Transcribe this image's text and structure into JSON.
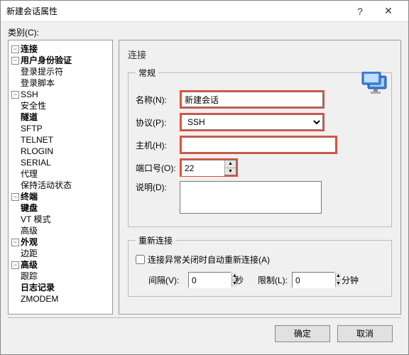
{
  "window": {
    "title": "新建会话属性",
    "help_glyph": "?",
    "close_glyph": "✕"
  },
  "tree": {
    "label": "类别(C):",
    "root": {
      "connection": {
        "label": "连接"
      },
      "auth": {
        "label": "用户身份验证"
      },
      "login_prompt": {
        "label": "登录提示符"
      },
      "login_script": {
        "label": "登录脚本"
      },
      "ssh": {
        "label": "SSH"
      },
      "security": {
        "label": "安全性"
      },
      "tunnel": {
        "label": "隧道"
      },
      "sftp": {
        "label": "SFTP"
      },
      "telnet": {
        "label": "TELNET"
      },
      "rlogin": {
        "label": "RLOGIN"
      },
      "serial": {
        "label": "SERIAL"
      },
      "proxy": {
        "label": "代理"
      },
      "keepalive": {
        "label": "保持活动状态"
      },
      "terminal": {
        "label": "终端"
      },
      "keyboard": {
        "label": "键盘"
      },
      "vtmode": {
        "label": "VT 模式"
      },
      "advanced_t": {
        "label": "高级"
      },
      "appearance": {
        "label": "外观"
      },
      "margin": {
        "label": "边距"
      },
      "advanced": {
        "label": "高级"
      },
      "trace": {
        "label": "跟踪"
      },
      "log": {
        "label": "日志记录"
      },
      "zmodem": {
        "label": "ZMODEM"
      }
    }
  },
  "panel": {
    "title": "连接",
    "general_legend": "常规",
    "name_label": "名称(N):",
    "name_value": "新建会话",
    "protocol_label": "协议(P):",
    "protocol_value": "SSH",
    "host_label": "主机(H):",
    "host_value": "",
    "port_label": "端口号(O):",
    "port_value": "22",
    "desc_label": "说明(D):",
    "desc_value": "",
    "reconnect_legend": "重新连接",
    "reconnect_chk": "连接异常关闭时自动重新连接(A)",
    "interval_label": "间隔(V):",
    "interval_value": "0",
    "seconds": "秒",
    "limit_label": "限制(L):",
    "limit_value": "0",
    "minutes": "分钟",
    "up": "▲",
    "down": "▼"
  },
  "footer": {
    "ok": "确定",
    "cancel": "取消"
  },
  "glyph": {
    "minus": "−",
    "plus": "+"
  }
}
